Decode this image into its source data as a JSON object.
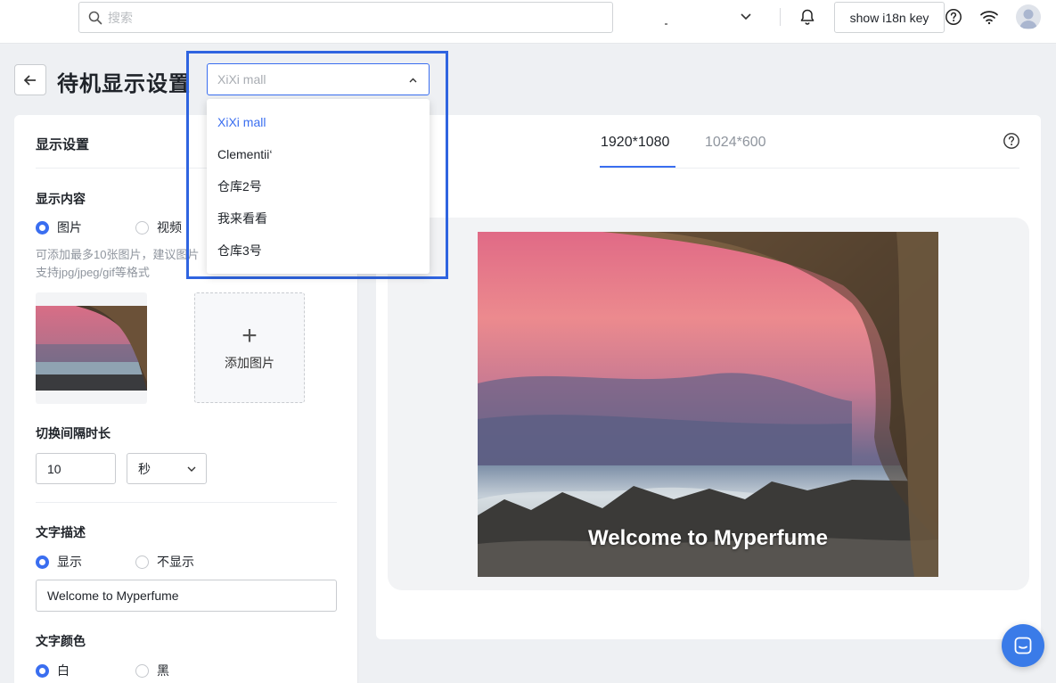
{
  "topbar": {
    "search_placeholder": "搜索",
    "i18n_button": "show i18n key"
  },
  "header": {
    "title": "待机显示设置",
    "back_icon": "arrow-left-icon"
  },
  "store_select": {
    "value": "XiXi mall",
    "options": [
      "XiXi mall",
      "Clementii‘",
      "仓库2号",
      "我来看看",
      "仓库3号"
    ],
    "selected_index": 0
  },
  "left": {
    "title": "显示设置",
    "content_section": "显示内容",
    "content_options": [
      "图片",
      "视频"
    ],
    "content_selected": "图片",
    "hint_line1": "可添加最多10张图片，建议图片",
    "hint_line2": "支持jpg/jpeg/gif等格式",
    "upload_label": "添加图片",
    "interval_section": "切换间隔时长",
    "interval_value": "10",
    "interval_unit": "秒",
    "text_section": "文字描述",
    "text_options": [
      "显示",
      "不显示"
    ],
    "text_selected": "显示",
    "text_value": "Welcome to Myperfume",
    "color_section": "文字颜色",
    "color_options": [
      "白",
      "黑"
    ],
    "color_selected": "白"
  },
  "right": {
    "tabs": [
      "1920*1080",
      "1024*600"
    ],
    "active_tab": "1920*1080",
    "preview_text": "Welcome to Myperfume"
  },
  "colors": {
    "accent": "#3a6ef0",
    "highlight_box": "#2f64e0"
  }
}
